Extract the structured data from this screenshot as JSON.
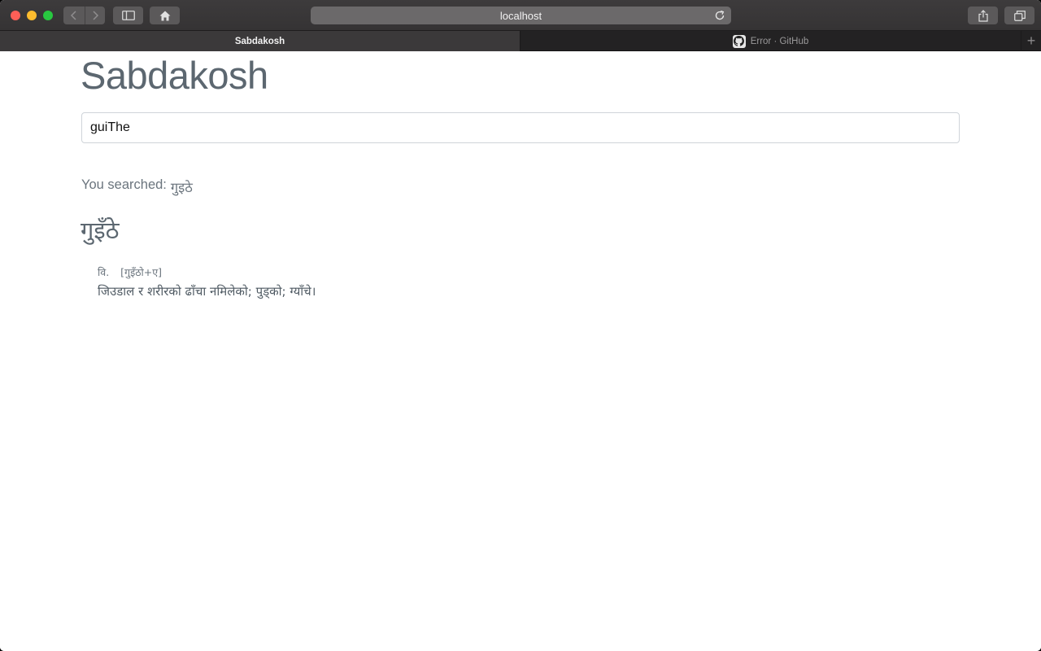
{
  "browser": {
    "url": "localhost",
    "tabs": [
      {
        "label": "Sabdakosh",
        "active": true
      },
      {
        "label": "Error · GitHub",
        "active": false
      }
    ],
    "new_tab_label": "+"
  },
  "page": {
    "title": "Sabdakosh",
    "search": {
      "value": "guiThe",
      "placeholder": ""
    },
    "searched_label": "You searched:",
    "searched_term": "गुइठे",
    "entry": {
      "word": "गुइँठे",
      "part_of_speech": "वि.",
      "etymology": "[गुइँठो+ए]",
      "definition": "जिउडाल र शरीरको ढाँचा नमिलेको; पुड्को; ग्याँचे।"
    }
  },
  "colors": {
    "title": "#5c6770",
    "text": "#6a747d",
    "toolbar": "#3d3b3c",
    "close": "#fe5f57",
    "minimize": "#febc2e",
    "maximize": "#28c840"
  }
}
